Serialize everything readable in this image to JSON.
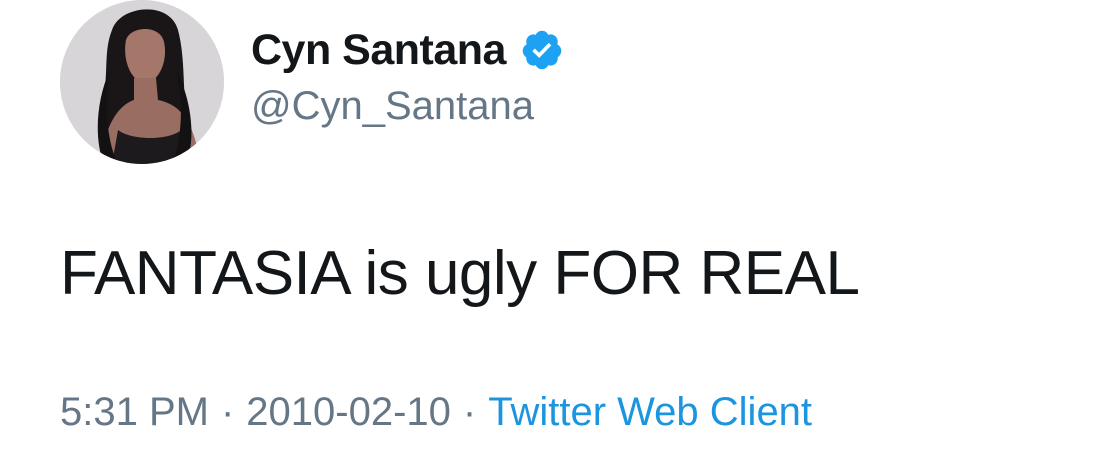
{
  "tweet": {
    "display_name": "Cyn Santana",
    "verified": true,
    "handle": "@Cyn_Santana",
    "text": "FANTASIA is ugly FOR REAL",
    "time": "5:31 PM",
    "separator": "·",
    "date": "2010-02-10",
    "client": "Twitter Web Client"
  },
  "icons": {
    "verified": "verified-badge-icon",
    "avatar": "profile-photo"
  },
  "colors": {
    "name": "#14171a",
    "secondary": "#657786",
    "link": "#1b95e0",
    "verified": "#1da1f2"
  }
}
